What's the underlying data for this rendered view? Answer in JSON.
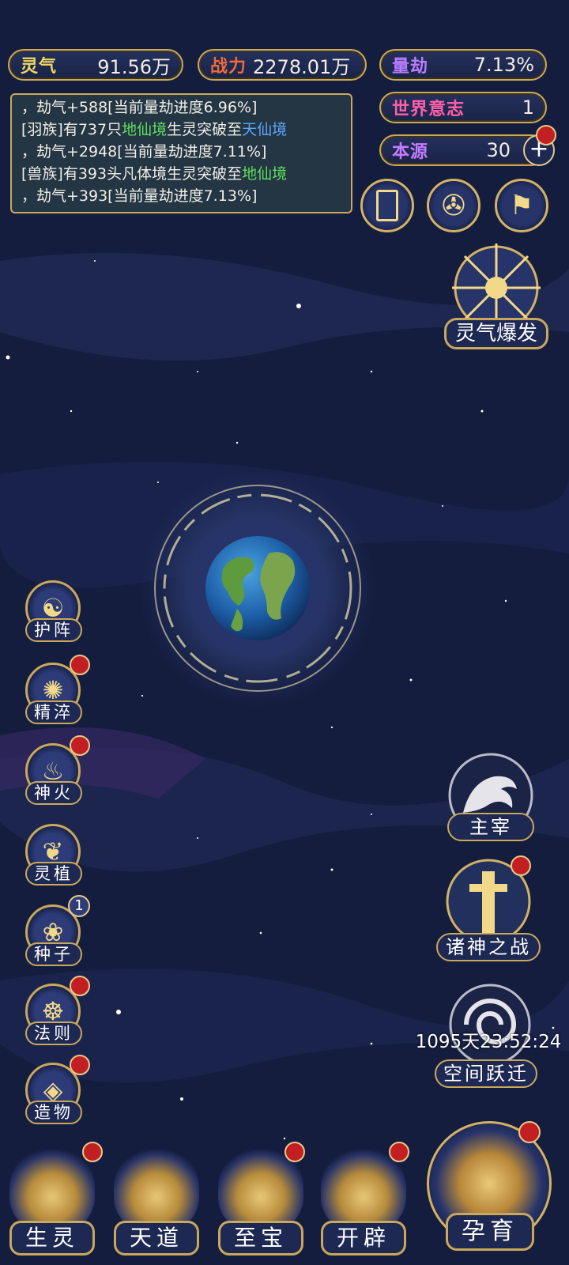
{
  "stats": {
    "lingqi": {
      "label": "灵气",
      "value": "91.56万",
      "color": "#f0d860"
    },
    "zhanli": {
      "label": "战力",
      "value": "2278.01万",
      "color": "#f06a3a"
    },
    "liangjie": {
      "label": "量劫",
      "value": "7.13%",
      "color": "#b77cff"
    },
    "world_will": {
      "label": "世界意志",
      "value": "1",
      "color": "#ff5fa8"
    },
    "benyuan": {
      "label": "本源",
      "value": "30",
      "color": "#c47cff"
    }
  },
  "log": {
    "l1": "，劫气+588[当前量劫进度6.96%]",
    "l2a": "[羽族]有737只",
    "l2b": "地仙境",
    "l2c": "生灵突破至",
    "l2d": "天仙境",
    "l3": "，劫气+2948[当前量劫进度7.11%]",
    "l4a": "[兽族]有393头凡体境生灵突破至",
    "l4b": "地仙境",
    "l5": "，劫气+393[当前量劫进度7.13%]"
  },
  "top_icons": [
    "card-icon",
    "vortex-icon",
    "flag-icon"
  ],
  "burst": {
    "label": "灵气爆发"
  },
  "side_menu": [
    {
      "label": "护阵",
      "icon": "yin-yang-icon",
      "glyph": "☯",
      "badge": ""
    },
    {
      "label": "精淬",
      "icon": "flame-lotus-icon",
      "glyph": "✺",
      "badge": "dot"
    },
    {
      "label": "神火",
      "icon": "divine-fire-icon",
      "glyph": "♨",
      "badge": "dot"
    },
    {
      "label": "灵植",
      "icon": "spirit-plant-icon",
      "glyph": "❦",
      "badge": ""
    },
    {
      "label": "种子",
      "icon": "seed-icon",
      "glyph": "❀",
      "badge": "1"
    },
    {
      "label": "法则",
      "icon": "law-toad-icon",
      "glyph": "☸",
      "badge": "dot"
    },
    {
      "label": "造物",
      "icon": "creation-icon",
      "glyph": "◈",
      "badge": "dot"
    }
  ],
  "right_menu": {
    "master": {
      "label": "主宰"
    },
    "war": {
      "label": "诸神之战"
    },
    "leap": {
      "label": "空间跃迁",
      "timer": "1095天23:52:24"
    }
  },
  "bottom_nav": [
    {
      "label": "生灵"
    },
    {
      "label": "天道"
    },
    {
      "label": "至宝"
    },
    {
      "label": "开辟"
    },
    {
      "label": "孕育"
    }
  ]
}
